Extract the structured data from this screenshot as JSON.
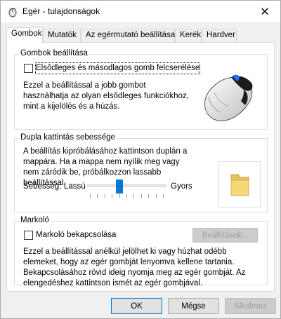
{
  "window": {
    "title": "Egér - tulajdonságok",
    "close_glyph": "✕"
  },
  "tabs": [
    {
      "label": "Gombok",
      "active": true
    },
    {
      "label": "Mutatók",
      "active": false
    },
    {
      "label": "Az egérmutató beállításai",
      "active": false
    },
    {
      "label": "Kerék",
      "active": false
    },
    {
      "label": "Hardver",
      "active": false
    }
  ],
  "buttons_group": {
    "title": "Gombok beállítása",
    "swap_checkbox_label": "Elsődleges és másodlagos gomb felcserélése",
    "swap_checked": false,
    "description": "Ezzel a beállítással a jobb gombot használhatja az olyan elsődleges funkciókhoz, mint a kijelölés és a húzás."
  },
  "double_click_group": {
    "title": "Dupla kattintás sebessége",
    "description": "A beállítás kipróbálásához kattintson duplán a mappára. Ha a mappa nem nyílik meg vagy nem záródik be, próbálkozzon lassabb beállítással.",
    "speed_label": "Sebesség:",
    "slow_label": "Lassú",
    "fast_label": "Gyors",
    "speed_value_fraction": 0.4,
    "tick_count": 11
  },
  "clicklock_group": {
    "title": "Markoló",
    "checkbox_label": "Markoló bekapcsolása",
    "checked": false,
    "settings_button": "Beállítások...",
    "description": "Ezzel a beállítással anélkül jelölhet ki vagy húzhat odébb elemeket, hogy az egér gombját lenyomva kellene tartania.  Bekapcsolásához rövid ideig nyomja meg az egér gombját.  Az elengedéshez kattintson ismét az egér gombjával."
  },
  "footer": {
    "ok": "OK",
    "cancel": "Mégse",
    "apply": "Alkalmaz"
  },
  "colors": {
    "accent": "#0078d7",
    "folder": "#f5d87a"
  }
}
